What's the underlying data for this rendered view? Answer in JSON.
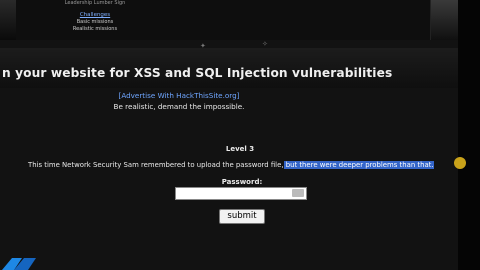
{
  "top": {
    "cut_text": "Leadership Lumber Sign",
    "challenges": "Challenges",
    "basic_missions": "Basic missions",
    "realistic_missions": "Realistic missions"
  },
  "banner": {
    "text": "n your website for XSS and SQL Injection vulnerabilities"
  },
  "advert": "[Advertise With HackThisSite.org]",
  "slogan": "Be realistic, demand the impossible.",
  "mission": {
    "level": "Level 3",
    "text_plain": "This time Network Security Sam remembered to upload the password file,",
    "text_highlight": " but there were deeper problems than that."
  },
  "form": {
    "password_label": "Password:",
    "password_value": "",
    "submit_label": "submit"
  },
  "colors": {
    "highlight": "#3465c9",
    "link": "#6fa6ff",
    "cursor": "#c9a21a"
  }
}
